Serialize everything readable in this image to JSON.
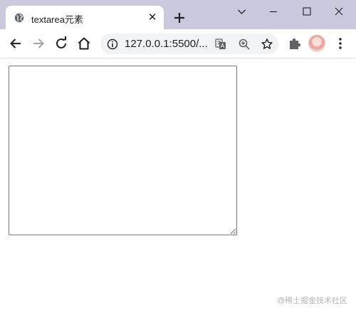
{
  "browser": {
    "tab": {
      "title": "textarea元素",
      "close_glyph": "✕",
      "favicon": "globe-icon"
    },
    "new_tab_icon": "plus-icon",
    "window_controls": [
      "chevron-down-icon",
      "minimize-icon",
      "maximize-icon",
      "close-icon"
    ],
    "toolbar": {
      "icons": [
        "back-arrow-icon",
        "forward-arrow-icon",
        "reload-icon",
        "home-icon"
      ],
      "address_bar": {
        "url": "127.0.0.1:5500/...",
        "icons": [
          "info-icon",
          "translate-icon",
          "zoom-icon",
          "bookmark-star-icon"
        ]
      },
      "extension_icon": "puzzle-icon",
      "menu_icon": "kebab-menu-icon"
    },
    "colors": {
      "tab_strip": "#c9c8dc",
      "toolbar": "#ffffff",
      "omnibox": "#f1f3f4",
      "textarea_border": "#767676"
    }
  },
  "page": {
    "textarea": {
      "value": ""
    }
  },
  "watermark": {
    "text": "@稀土掘金技术社区"
  }
}
